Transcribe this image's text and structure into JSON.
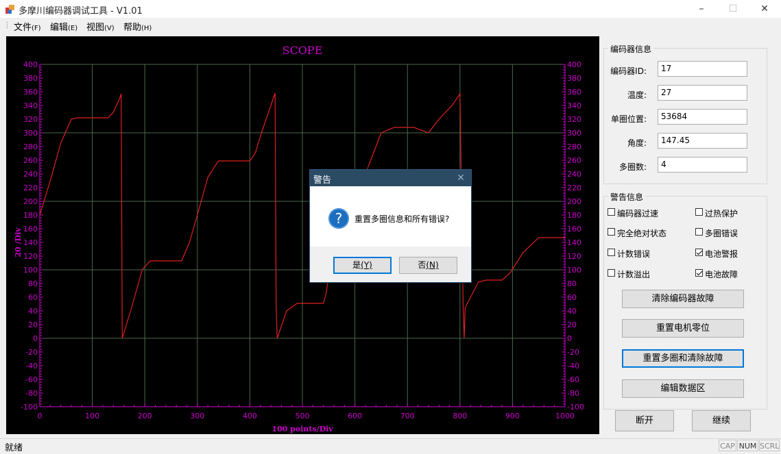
{
  "window": {
    "title": "多摩川编码器调试工具 - V1.01"
  },
  "menu": [
    {
      "label": "文件",
      "accel": "(F)"
    },
    {
      "label": "编辑",
      "accel": "(E)"
    },
    {
      "label": "视图",
      "accel": "(V)"
    },
    {
      "label": "帮助",
      "accel": "(H)"
    }
  ],
  "chart_data": {
    "type": "line",
    "title": "SCOPE",
    "xlabel": "100 points/Div",
    "ylabel": "20 /Div",
    "xlim": [
      0,
      1000
    ],
    "ylim": [
      -100,
      400
    ],
    "x_ticks": [
      "0",
      "100",
      "200",
      "300",
      "400",
      "500",
      "600",
      "700",
      "800",
      "900",
      "1000"
    ],
    "y_ticks": [
      "400",
      "380",
      "360",
      "340",
      "320",
      "300",
      "280",
      "260",
      "240",
      "220",
      "200",
      "180",
      "160",
      "140",
      "120",
      "100",
      "80",
      "60",
      "40",
      "20",
      "0",
      "-20",
      "-40",
      "-60",
      "-80",
      "-100"
    ],
    "grid": true,
    "series": [
      {
        "color": "#e02020",
        "x": [
          0,
          20,
          40,
          60,
          72,
          130,
          140,
          152,
          154,
          155,
          157,
          175,
          195,
          210,
          270,
          285,
          300,
          320,
          340,
          400,
          410,
          422,
          448,
          450,
          452,
          470,
          490,
          500,
          540,
          545,
          552,
          577,
          600,
          625,
          650,
          675,
          700,
          705,
          712,
          740,
          760,
          785,
          800,
          806,
          808,
          810,
          835,
          850,
          880,
          895,
          920,
          950,
          990,
          1000
        ],
        "y": [
          180,
          230,
          285,
          320,
          322,
          322,
          330,
          350,
          355,
          357,
          0,
          45,
          100,
          113,
          113,
          140,
          180,
          235,
          259,
          259,
          270,
          300,
          358,
          50,
          0,
          40,
          51,
          51,
          51,
          65,
          100,
          150,
          200,
          250,
          300,
          308,
          308,
          308,
          308,
          300,
          320,
          340,
          357,
          50,
          0,
          45,
          82,
          85,
          85,
          95,
          125,
          147,
          147,
          147
        ]
      }
    ]
  },
  "encoder_info": {
    "group_title": "编码器信息",
    "fields": [
      {
        "label": "编码器ID:",
        "value": "17"
      },
      {
        "label": "温度:",
        "value": "27"
      },
      {
        "label": "单圈位置:",
        "value": "53684"
      },
      {
        "label": "角度:",
        "value": "147.45"
      },
      {
        "label": "多圈数:",
        "value": "4"
      }
    ]
  },
  "alarm_info": {
    "group_title": "警告信息",
    "checks": [
      {
        "label": "编码器过速",
        "checked": false
      },
      {
        "label": "过热保护",
        "checked": false
      },
      {
        "label": "完全绝对状态",
        "checked": false
      },
      {
        "label": "多圈错误",
        "checked": false
      },
      {
        "label": "计数错误",
        "checked": false
      },
      {
        "label": "电池警报",
        "checked": true
      },
      {
        "label": "计数溢出",
        "checked": false
      },
      {
        "label": "电池故障",
        "checked": true
      }
    ],
    "buttons": [
      "清除编码器故障",
      "重置电机零位",
      "重置多圈和清除故障",
      "编辑数据区"
    ]
  },
  "bottom_buttons": {
    "disconnect": "断开",
    "continue": "继续"
  },
  "status": {
    "text": "就绪",
    "indicators": [
      "CAP",
      "NUM",
      "SCRL"
    ]
  },
  "dialog": {
    "title": "警告",
    "message": "重置多圈信息和所有错误?",
    "yes_label": "是",
    "yes_accel": "(Y)",
    "no_label": "否",
    "no_accel": "(N)"
  },
  "colors": {
    "scope_bg": "#000000",
    "grid": "#4a6a4a",
    "axis": "#cc00cc",
    "trace": "#e02020"
  }
}
